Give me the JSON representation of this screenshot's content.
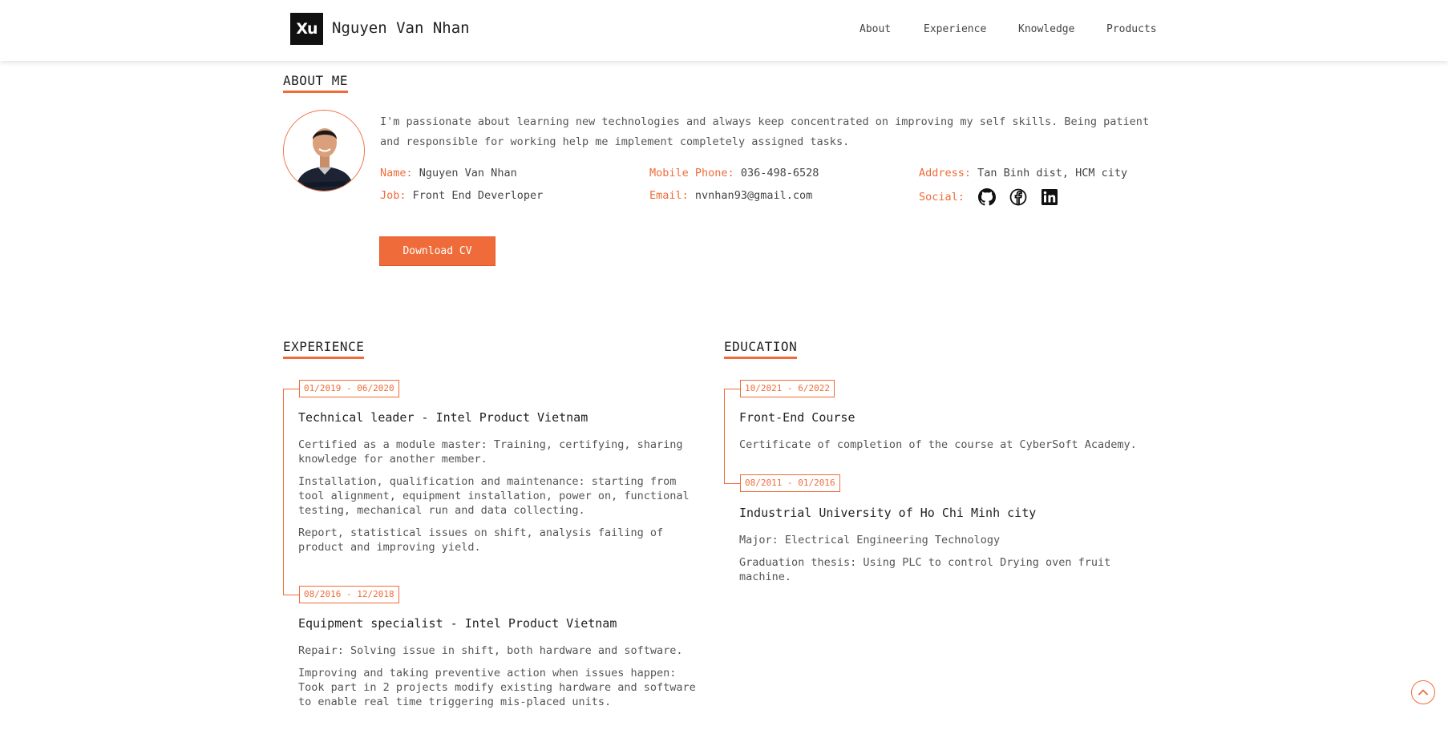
{
  "header": {
    "logo_text": "Xu",
    "site_name": "Nguyen Van Nhan",
    "nav": [
      "About",
      "Experience",
      "Knowledge",
      "Products"
    ]
  },
  "about": {
    "title": "ABOUT ME",
    "description": "I'm passionate about learning new technologies and always keep concentrated on improving my self skills. Being patient and responsible for working help me implement completely assigned tasks.",
    "fields": {
      "name_label": "Name:",
      "name_value": "Nguyen Van Nhan",
      "job_label": "Job:",
      "job_value": "Front End Deverloper",
      "phone_label": "Mobile Phone:",
      "phone_value": "036-498-6528",
      "email_label": "Email:",
      "email_value": "nvnhan93@gmail.com",
      "address_label": "Address:",
      "address_value": "Tan Binh dist, HCM city",
      "social_label": "Social:"
    },
    "social_icons": [
      "github-icon",
      "facebook-icon",
      "linkedin-icon"
    ],
    "cv_button": "Download CV"
  },
  "experience": {
    "title": "EXPERIENCE",
    "items": [
      {
        "date": "01/2019 - 06/2020",
        "title": "Technical leader - Intel Product Vietnam",
        "details": [
          "Certified as a module master: Training, certifying, sharing knowledge for another member.",
          "Installation, qualification and maintenance: starting from tool alignment, equipment installation, power on, functional testing, mechanical run and data collecting.",
          "Report, statistical issues on shift, analysis failing of product and improving yield."
        ]
      },
      {
        "date": "08/2016 - 12/2018",
        "title": "Equipment specialist - Intel Product Vietnam",
        "details": [
          "Repair: Solving issue in shift, both hardware and software.",
          "Improving and taking preventive action when issues happen: Took part in 2 projects modify existing hardware and software to enable real time triggering mis-placed units."
        ]
      }
    ]
  },
  "education": {
    "title": "EDUCATION",
    "items": [
      {
        "date": "10/2021 - 6/2022",
        "title": "Front-End Course",
        "details": [
          "Certificate of completion of the course at CyberSoft Academy."
        ]
      },
      {
        "date": "08/2011 - 01/2016",
        "title": "Industrial University of Ho Chi Minh city",
        "details": [
          "Major: Electrical Engineering Technology",
          "Graduation thesis: Using PLC to control Drying oven fruit machine."
        ]
      }
    ]
  },
  "colors": {
    "accent": "#ef6c3a",
    "text": "#333333",
    "logo_bg": "#111111"
  }
}
